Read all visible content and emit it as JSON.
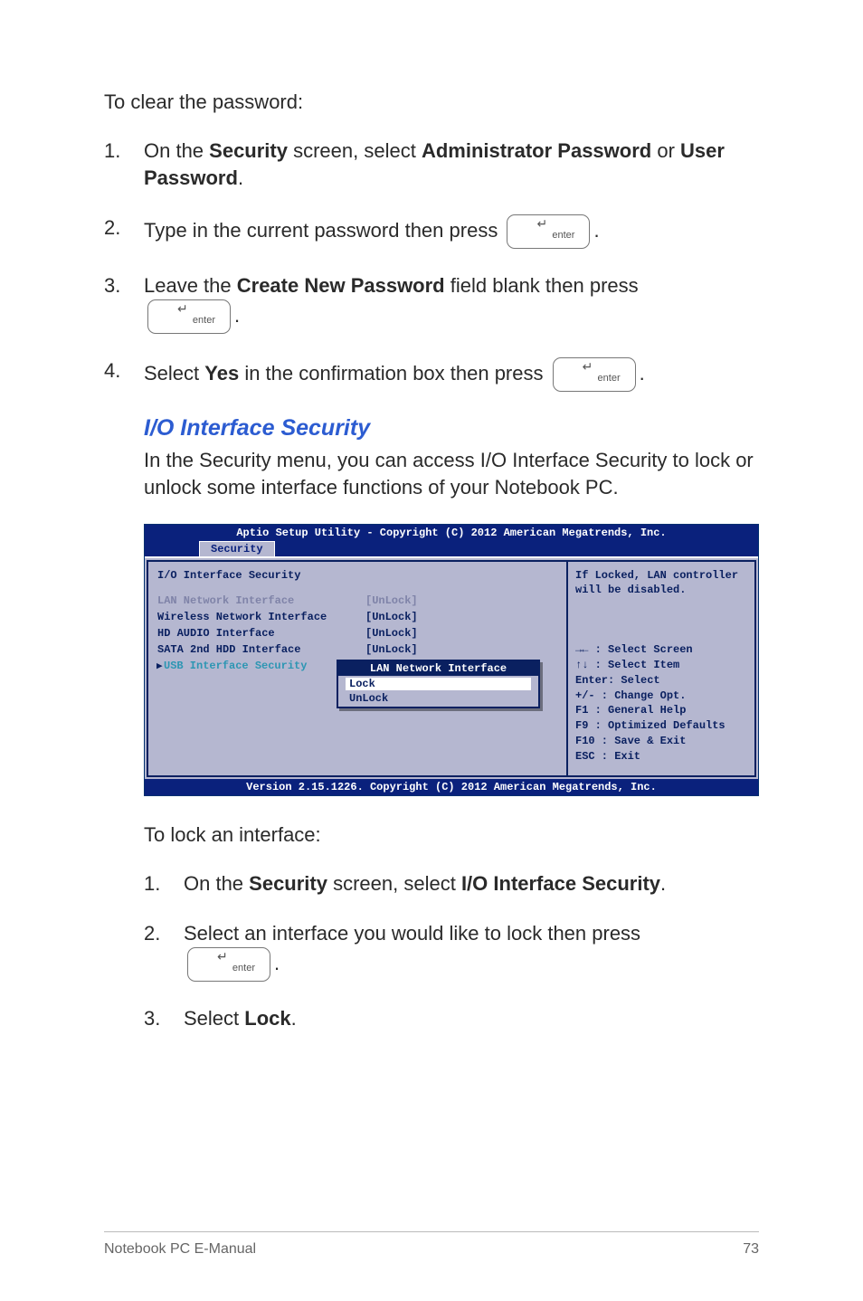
{
  "intro": "To clear the password:",
  "steps": [
    {
      "prefix": "On the ",
      "b1": "Security",
      "mid": " screen, select ",
      "b2": "Administrator Password",
      "mid2": " or ",
      "b3": "User Password",
      "suffix": "."
    },
    {
      "text": "Type in the current password then press ",
      "suffix": "."
    },
    {
      "prefix": "Leave the ",
      "b1": "Create New Password",
      "mid": " field blank then press",
      "suffix": "."
    },
    {
      "prefix": "Select ",
      "b1": "Yes",
      "mid": " in the confirmation box then press ",
      "suffix": "."
    }
  ],
  "iosec": {
    "heading": "I/O Interface Security",
    "text": "In the Security menu, you can access I/O Interface Security to lock or unlock some interface functions of your Notebook PC."
  },
  "bios": {
    "copyright": "Aptio Setup Utility - Copyright (C) 2012 American Megatrends, Inc.",
    "tab": "Security",
    "panel_title": "I/O Interface Security",
    "rows": [
      {
        "label": "LAN Network Interface",
        "value": "[UnLock]",
        "style": "muted"
      },
      {
        "label": "Wireless Network Interface",
        "value": "[UnLock]",
        "style": "blue"
      },
      {
        "label": "HD AUDIO Interface",
        "value": "[UnLock]",
        "style": "blue"
      },
      {
        "label": "SATA 2nd HDD Interface",
        "value": "[UnLock]",
        "style": "blue"
      },
      {
        "label": "USB Interface Security",
        "value": "",
        "style": "cyan",
        "arrow": true
      }
    ],
    "popup": {
      "title": "LAN Network Interface",
      "opt_selected": "Lock",
      "opt_other": "UnLock"
    },
    "help": "If Locked, LAN controller will be disabled.",
    "keys": {
      "k1": "→←  : Select Screen",
      "k2": "↑↓  : Select Item",
      "k3": "Enter: Select",
      "k4": "+/-  : Change Opt.",
      "k5": "F1   : General Help",
      "k6": "F9   : Optimized Defaults",
      "k7": "F10  : Save & Exit",
      "k8": "ESC  : Exit"
    },
    "footer": "Version 2.15.1226. Copyright (C) 2012 American Megatrends, Inc."
  },
  "intro2": "To lock an interface:",
  "steps2": [
    {
      "prefix": "On the ",
      "b1": "Security",
      "mid": " screen, select ",
      "b2": "I/O Interface Security",
      "suffix": "."
    },
    {
      "text": "Select an interface you would like to lock then press",
      "suffix": "."
    },
    {
      "prefix": "Select ",
      "b1": "Lock",
      "suffix": "."
    }
  ],
  "footer": {
    "left": "Notebook PC E-Manual",
    "right": "73"
  },
  "key_label": "enter"
}
